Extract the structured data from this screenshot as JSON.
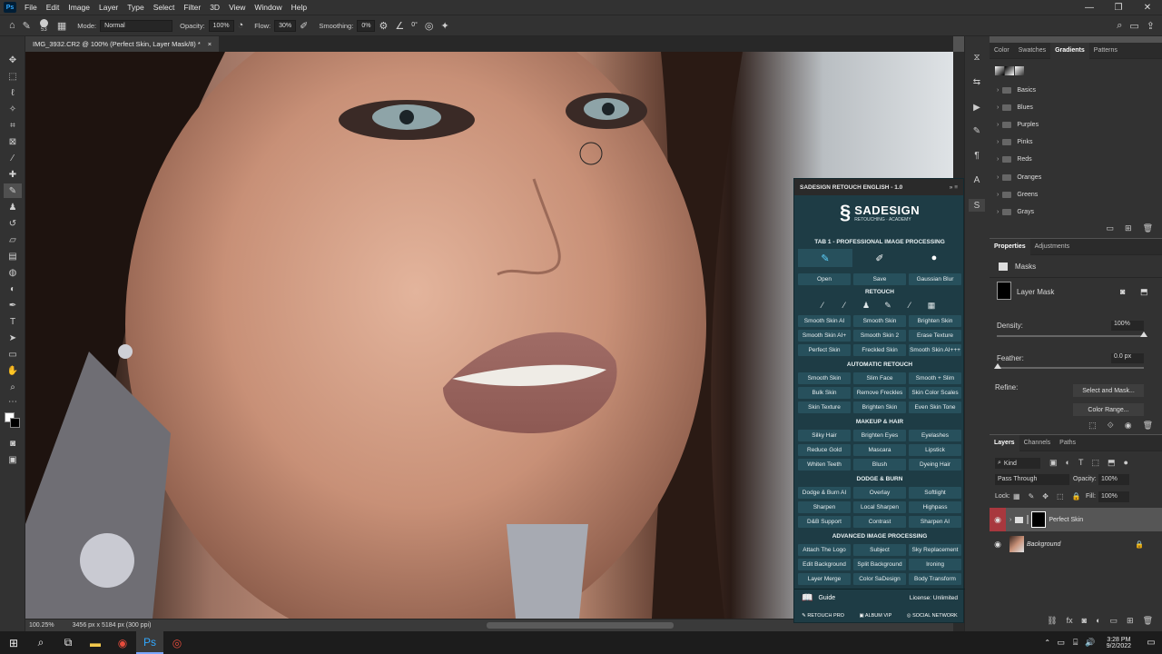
{
  "menubar": {
    "logo": "Ps",
    "items": [
      "File",
      "Edit",
      "Image",
      "Layer",
      "Type",
      "Select",
      "Filter",
      "3D",
      "View",
      "Window",
      "Help"
    ]
  },
  "options": {
    "brush_size": "53",
    "mode_label": "Mode:",
    "mode_value": "Normal",
    "opacity_label": "Opacity:",
    "opacity_value": "100%",
    "flow_label": "Flow:",
    "flow_value": "30%",
    "smoothing_label": "Smoothing:",
    "smoothing_value": "0%",
    "angle_value": "0°"
  },
  "document": {
    "tab_title": "IMG_3932.CR2 @ 100% (Perfect Skin, Layer Mask/8) *",
    "close": "×",
    "zoom": "100.25%",
    "dims": "3456 px x 5184 px (300 ppi)"
  },
  "gradients_panel": {
    "tabs": [
      "Color",
      "Swatches",
      "Gradients",
      "Patterns"
    ],
    "active_tab": "Gradients",
    "groups": [
      "Basics",
      "Blues",
      "Purples",
      "Pinks",
      "Reds",
      "Oranges",
      "Greens",
      "Grays"
    ]
  },
  "properties_panel": {
    "tabs": [
      "Properties",
      "Adjustments"
    ],
    "section": "Masks",
    "layer_mask": "Layer Mask",
    "density_label": "Density:",
    "density_value": "100%",
    "density_fraction": 1.0,
    "feather_label": "Feather:",
    "feather_value": "0.0 px",
    "refine_label": "Refine:",
    "select_and_mask": "Select and Mask...",
    "color_range": "Color Range..."
  },
  "layers_panel": {
    "tabs": [
      "Layers",
      "Channels",
      "Paths"
    ],
    "kind": "Kind",
    "blend_mode": "Pass Through",
    "opacity_label": "Opacity:",
    "opacity_value": "100%",
    "lock_label": "Lock:",
    "fill_label": "Fill:",
    "fill_value": "100%",
    "layers": [
      {
        "name": "Perfect Skin",
        "selected": true
      },
      {
        "name": "Background",
        "selected": false
      }
    ]
  },
  "sadesign": {
    "title": "SADESIGN RETOUCH ENGLISH - 1.0",
    "logo_name": "SADESIGN",
    "logo_sub": "RETOUCHING · ACADEMY",
    "tab_title": "TAB 1 - PROFESSIONAL IMAGE PROCESSING",
    "top_buttons": [
      "Open",
      "Save",
      "Gaussian Blur"
    ],
    "sections": [
      {
        "title": "RETOUCH",
        "buttons": [
          "Smooth Skin AI",
          "Smooth Skin",
          "Brighten Skin",
          "Smooth Skin AI+",
          "Smooth Skin 2",
          "Erase Texture",
          "Perfect Skin",
          "Freckled Skin",
          "Smooth Skin AI+++"
        ]
      },
      {
        "title": "AUTOMATIC RETOUCH",
        "buttons": [
          "Smooth Skin",
          "Slim Face",
          "Smooth + Slim",
          "Bulk Skin",
          "Remove Freckles",
          "Skin Color Scales",
          "Skin Texture",
          "Brighten Skin",
          "Even Skin Tone"
        ]
      },
      {
        "title": "MAKEUP & HAIR",
        "buttons": [
          "Silky Hair",
          "Brighten Eyes",
          "Eyelashes",
          "Reduce Gold",
          "Mascara",
          "Lipstick",
          "Whiten Teeth",
          "Blush",
          "Dyeing Hair"
        ]
      },
      {
        "title": "DODGE & BURN",
        "buttons": [
          "Dodge & Burn AI",
          "Overlay",
          "Softlight",
          "Sharpen",
          "Local Sharpen",
          "Highpass",
          "D&B Support",
          "Contrast",
          "Sharpen AI"
        ]
      },
      {
        "title": "ADVANCED IMAGE PROCESSING",
        "buttons": [
          "Attach The Logo",
          "Subject",
          "Sky Replacement",
          "Edit Background",
          "Split Background",
          "Ironing",
          "Layer Merge",
          "Color SaDesign",
          "Body Transform"
        ]
      }
    ],
    "guide": "Guide",
    "license": "License: Unlimited",
    "footer": [
      "RETOUCH PRO",
      "ALBUM VIP",
      "SOCIAL NETWORK"
    ]
  },
  "taskbar": {
    "time": "3:28 PM",
    "date": "9/2/2022"
  }
}
